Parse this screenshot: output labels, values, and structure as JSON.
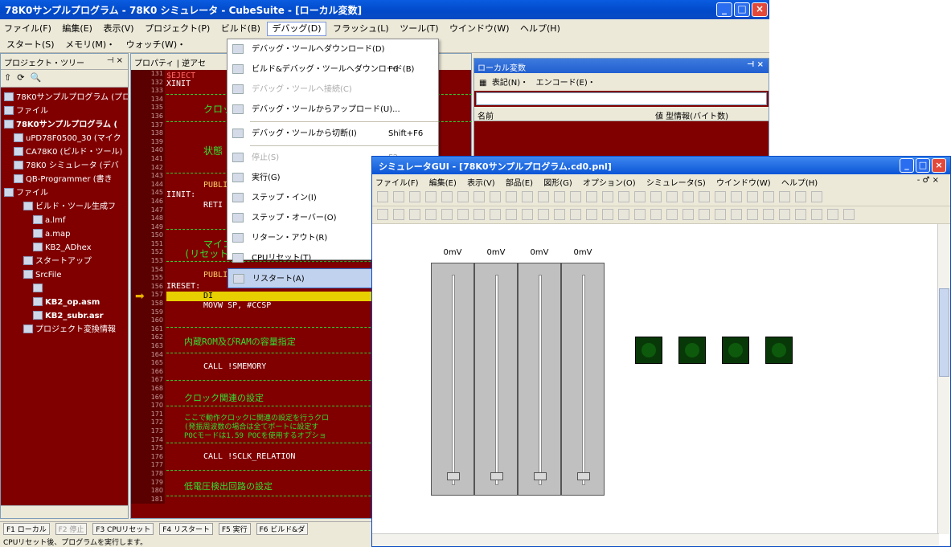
{
  "main": {
    "title": "78K0サンプルプログラム - 78K0 シミュレータ - CubeSuite - [ローカル変数]",
    "menu": [
      "ファイル(F)",
      "編集(E)",
      "表示(V)",
      "プロジェクト(P)",
      "ビルド(B)",
      "デバッグ(D)",
      "フラッシュ(L)",
      "ツール(T)",
      "ウインドウ(W)",
      "ヘルプ(H)"
    ],
    "toolbar": [
      "スタート(S)",
      "メモリ(M)・",
      "ウォッチ(W)・"
    ]
  },
  "project_tree": {
    "title": "プロジェクト・ツリー",
    "items": [
      {
        "label": "78K0サンプルプログラム (プロジェ",
        "bold": false
      },
      {
        "label": "ファイル",
        "bold": false
      },
      {
        "label": "78K0サンプルプログラム (",
        "bold": true
      },
      {
        "label": "uPD78F0500_30 (マイク",
        "bold": false
      },
      {
        "label": "CA78K0 (ビルド・ツール)",
        "bold": false
      },
      {
        "label": "78K0 シミュレータ (デバ",
        "bold": false
      },
      {
        "label": "QB-Programmer (書き",
        "bold": false
      },
      {
        "label": "ファイル",
        "bold": false
      },
      {
        "label": "ビルド・ツール生成フ",
        "bold": false
      },
      {
        "label": "a.lmf",
        "bold": false
      },
      {
        "label": "a.map",
        "bold": false
      },
      {
        "label": "KB2_ADhex",
        "bold": false
      },
      {
        "label": "スタートアップ",
        "bold": false
      },
      {
        "label": "SrcFile",
        "bold": false
      },
      {
        "label": "",
        "bold": false
      },
      {
        "label": "KB2_op.asm",
        "bold": true
      },
      {
        "label": "KB2_subr.asr",
        "bold": true
      },
      {
        "label": "プロジェクト変換情報",
        "bold": false
      }
    ]
  },
  "editor": {
    "tabs": [
      "プロパティ",
      "逆アセ"
    ],
    "gutter_lines": [
      "131",
      "132",
      "133",
      "134",
      "135",
      "136",
      "137",
      "138",
      "139",
      "140",
      "141",
      "142",
      "143",
      "144",
      "145",
      "146",
      "147",
      "148",
      "149",
      "150",
      "151",
      "152",
      "153",
      "154",
      "155",
      "156",
      "157",
      "158",
      "159",
      "160",
      "161",
      "162",
      "163",
      "164",
      "165",
      "166",
      "167",
      "168",
      "169",
      "170",
      "171",
      "172",
      "173",
      "174",
      "175",
      "176",
      "177",
      "178",
      "179",
      "180",
      "181"
    ],
    "code": {
      "l1": "$EJECT",
      "l2": "XINIT",
      "l3": "クロック",
      "l4": "状態",
      "l5": "PUBLIC",
      "l6": "IINIT:",
      "l7": "RETI",
      "l8": "マイコ",
      "l9": "(リセット",
      "l10": "PUBLIC   IRESET",
      "l11": "IRESET:",
      "l12": "DI",
      "l13": "MOVW     SP,         #CCSP",
      "l14": "内蔵ROM及びRAMの容量指定",
      "l15": "CALL     !SMEMORY",
      "l16": "クロック関連の設定",
      "l17": "ここで動作クロックに関連の設定を行うクロ",
      "l18": "(発振周波数の場合は全てポートに設定す",
      "l19": "POCモードは1.59 POCを使用するオプショ",
      "l20": "CALL     !SCLK_RELATION",
      "l21": "低電圧検出回路の設定"
    }
  },
  "debug_menu": {
    "items": [
      {
        "label": "デバッグ・ツールへダウンロード(D)",
        "shortcut": "",
        "disabled": false
      },
      {
        "label": "ビルド&デバッグ・ツールへダウンロード(B)",
        "shortcut": "F6",
        "disabled": false
      },
      {
        "label": "デバッグ・ツールへ接続(C)",
        "shortcut": "",
        "disabled": true
      },
      {
        "label": "デバッグ・ツールからアップロード(U)...",
        "shortcut": "",
        "disabled": false
      },
      {
        "label": "デバッグ・ツールから切断(I)",
        "shortcut": "Shift+F6",
        "disabled": false
      },
      {
        "label": "停止(S)",
        "shortcut": "F2",
        "disabled": true
      },
      {
        "label": "実行(G)",
        "shortcut": "",
        "disabled": false
      },
      {
        "label": "ステップ・イン(I)",
        "shortcut": "",
        "disabled": false
      },
      {
        "label": "ステップ・オーバー(O)",
        "shortcut": "",
        "disabled": false
      },
      {
        "label": "リターン・アウト(R)",
        "shortcut": "",
        "disabled": false
      },
      {
        "label": "CPUリセット(T)",
        "shortcut": "",
        "disabled": false
      },
      {
        "label": "リスタート(A)",
        "shortcut": "",
        "disabled": false,
        "hover": true
      }
    ]
  },
  "local_vars": {
    "title": "ローカル変数",
    "toolbar": [
      "表記(N)・",
      "エンコード(E)・"
    ],
    "col_name": "名前",
    "col_value": "値  型情報(バイト数)"
  },
  "statusbar": {
    "fkeys": [
      "F1 ローカル",
      "F2 停止",
      "F3 CPUリセット",
      "F4 リスタート",
      "F5 実行",
      "F6 ビルド&ダ"
    ],
    "text": "CPUリセット後、プログラムを実行します。"
  },
  "sim": {
    "title": "シミュレータGUI - [78K0サンプルプログラム.cd0.pnl]",
    "menu": [
      "ファイル(F)",
      "編集(E)",
      "表示(V)",
      "部品(E)",
      "図形(G)",
      "オプション(O)",
      "シミュレータ(S)",
      "ウインドウ(W)",
      "ヘルプ(H)"
    ],
    "winctl": "- ♂ ×",
    "sliders": [
      {
        "label": "0mV",
        "value": 0
      },
      {
        "label": "0mV",
        "value": 0
      },
      {
        "label": "0mV",
        "value": 0
      },
      {
        "label": "0mV",
        "value": 0
      }
    ],
    "leds": 4
  }
}
